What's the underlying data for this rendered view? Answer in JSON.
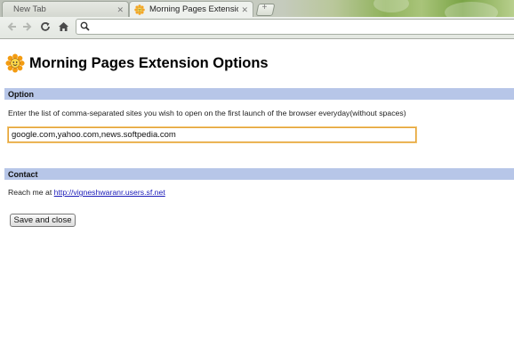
{
  "browser": {
    "tabs": [
      {
        "title": "New Tab",
        "active": false
      },
      {
        "title": "Morning Pages Extension O",
        "active": true
      }
    ],
    "omnibox_value": ""
  },
  "page": {
    "title": "Morning Pages Extension Options",
    "option_section": {
      "heading": "Option",
      "description": "Enter the list of comma-separated sites you wish to open on the first launch of the browser everyday(without spaces)",
      "sites_value": "google.com,yahoo.com,news.softpedia.com"
    },
    "contact_section": {
      "heading": "Contact",
      "reach_text": "Reach me at ",
      "link_text": "http://vigneshwaranr.users.sf.net"
    },
    "save_button_label": "Save and close"
  },
  "colors": {
    "section_bar": "#b7c6e8",
    "link": "#1a1ab8",
    "input_focus_border": "#e3a33a"
  }
}
